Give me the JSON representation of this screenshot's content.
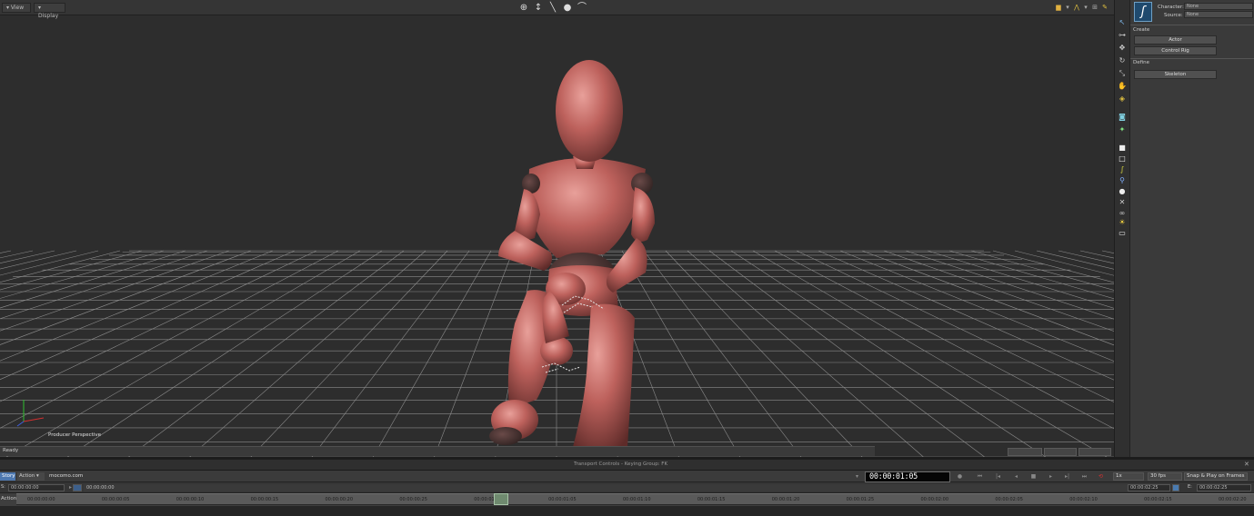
{
  "viewport": {
    "menu_view": "View",
    "menu_display": "Display",
    "label": "Producer Perspective",
    "status": "Ready",
    "mini_buttons": [
      "",
      "",
      ""
    ],
    "colors": {
      "background": "#2d2d2d",
      "grid": "#8c8c8c",
      "figure": "#b25a56"
    }
  },
  "char_panel": {
    "character_label": "Character:",
    "character_value": "None",
    "source_label": "Source:",
    "source_value": "None",
    "create_label": "Create",
    "actor_button": "Actor",
    "control_rig_button": "Control Rig",
    "define_label": "Define",
    "skeleton_button": "Skeleton"
  },
  "transport": {
    "title": "Transport Controls  -  Keying Group: FK",
    "story_tab": "Story",
    "action_tab": "Action",
    "take_name": "mocomo.com",
    "time_display": "00:00:01:05",
    "speed": "1x",
    "fps": "30 fps",
    "snap_mode": "Snap & Play on Frames",
    "start_label": "S:",
    "start_time": "00:00:00:00",
    "current_time": "00:00:00:00",
    "end_label": "E:",
    "end_time_a": "00:00:02:25",
    "end_time_b": "00:00:02:25",
    "row_label": "Action",
    "timeline_labels": [
      "00:00:00:00",
      "00:00:00:05",
      "00:00:00:10",
      "00:00:00:15",
      "00:00:00:20",
      "00:00:00:25",
      "00:00:01:00",
      "00:00:01:05",
      "00:00:01:10",
      "00:00:01:15",
      "00:00:01:20",
      "00:00:01:25",
      "00:00:02:00",
      "00:00:02:05",
      "00:00:02:10",
      "00:00:02:15",
      "00:00:02:20"
    ],
    "current_frame_fraction": 0.386
  }
}
